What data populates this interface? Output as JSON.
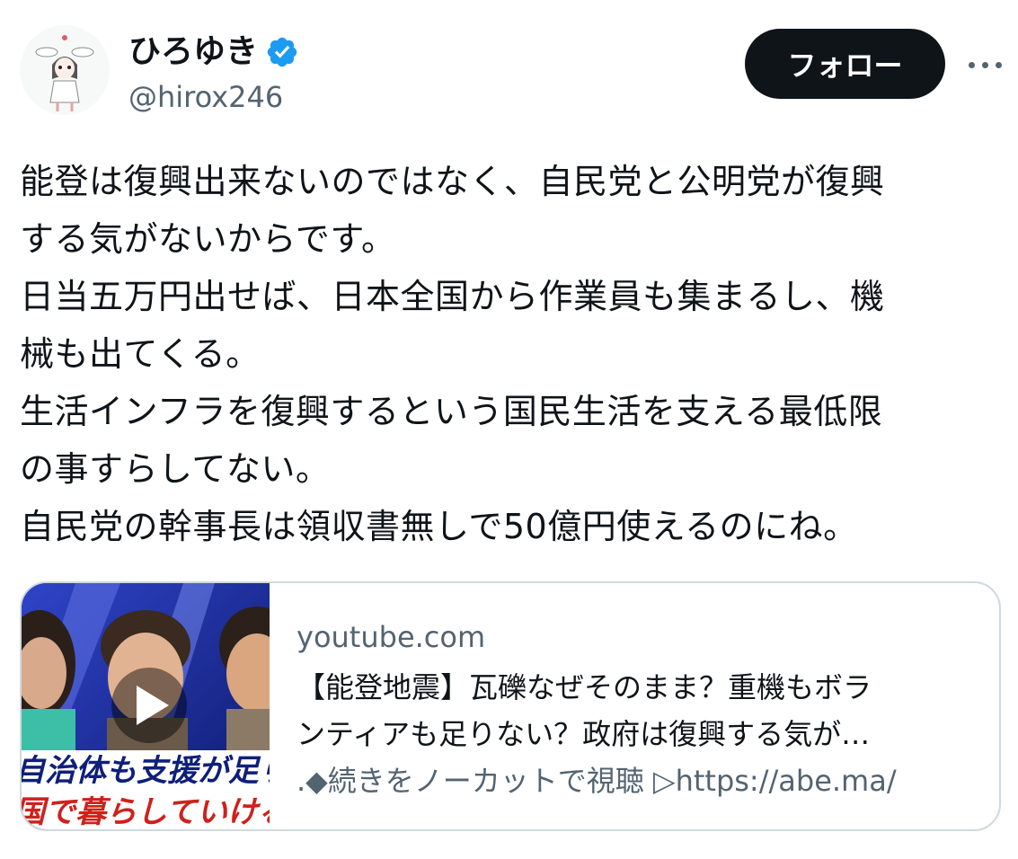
{
  "user": {
    "display_name": "ひろゆき",
    "handle": "@hirox246",
    "verified": true
  },
  "actions": {
    "follow_label": "フォロー",
    "more_icon": "more-horizontal-icon"
  },
  "tweet": {
    "lines": [
      "能登は復興出来ないのではなく、自民党と公明党が復興",
      "する気がないからです。",
      "日当五万円出せば、日本全国から作業員も集まるし、機",
      "械も出てくる。",
      "生活インフラを復興するという国民生活を支える最低限",
      "の事すらしてない。",
      "自民党の幹事長は領収書無しで50億円使えるのにね。"
    ]
  },
  "link_card": {
    "domain": "youtube.com",
    "title_line1": "【能登地震】瓦礫なぜそのまま？重機もボラ",
    "title_line2": "ンティアも足りない？政府は復興する気が…",
    "description": ".◆続きをノーカットで視聴 ▷https://abe.ma/",
    "thumbnail": {
      "caption_line1": "自治体も支援が足りな",
      "caption_line2": "国で暮らしていけるの",
      "play_icon": "play-icon"
    }
  },
  "colors": {
    "text": "#0f1419",
    "secondary": "#536471",
    "verified_blue": "#1d9bf0",
    "border": "#cfd9de",
    "button_bg": "#0f1419"
  }
}
